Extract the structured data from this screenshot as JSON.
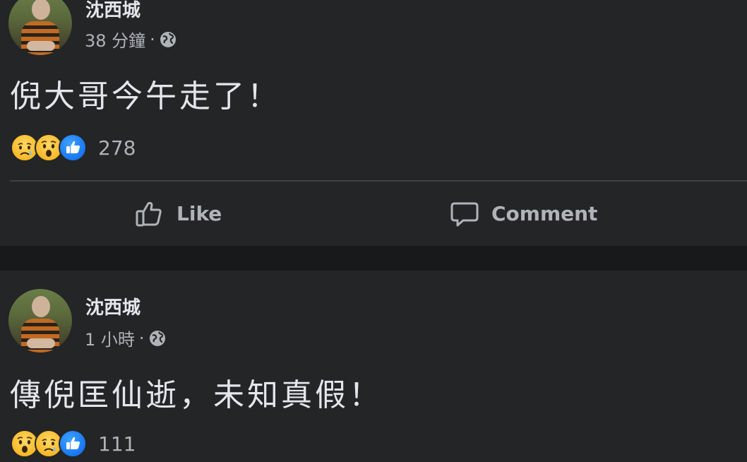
{
  "posts": [
    {
      "author": "沈西城",
      "time": "38 分鐘",
      "separator": "·",
      "text": "倪大哥今午走了！",
      "reaction_count": "278",
      "reactions": [
        "sad-icon",
        "wow-icon",
        "like-icon"
      ]
    },
    {
      "author": "沈西城",
      "time": "1 小時",
      "separator": "·",
      "text": "傳倪匡仙逝，未知真假！",
      "reaction_count": "111",
      "reactions": [
        "wow-icon",
        "sad-icon",
        "like-icon"
      ]
    }
  ],
  "actions": {
    "like_label": "Like",
    "comment_label": "Comment"
  },
  "colors": {
    "page_bg": "#18191a",
    "card_bg": "#242526",
    "primary_text": "#e4e6eb",
    "secondary_text": "#b0b3b8",
    "like_blue": "#1877f2",
    "emoji_yellow": "#f7b928"
  }
}
